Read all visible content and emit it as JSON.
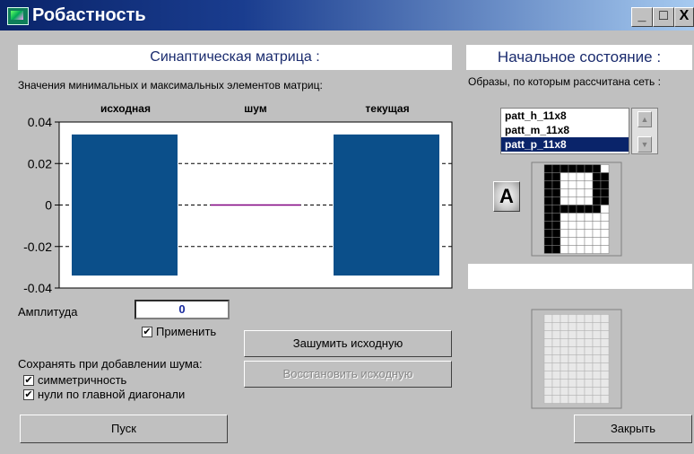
{
  "window": {
    "title": "Робастность",
    "minimize": "_",
    "maximize": "□",
    "close": "X"
  },
  "synaptic": {
    "header": "Синаптическая матрица :",
    "caption": "Значения минимальных и максимальных элементов матриц:",
    "col_labels": [
      "исходная",
      "шум",
      "текущая"
    ],
    "amplitude_label": "Амплитуда",
    "amplitude_value": "0",
    "apply_label": "Применить",
    "apply_checked": true,
    "save_caption": "Сохранять при добавлении шума:",
    "symmetry_label": "симметричность",
    "symmetry_checked": true,
    "zeros_label": "нули по главной диагонали",
    "zeros_checked": true,
    "noise_button": "Зашумить исходную",
    "restore_button": "Восстановить исходную",
    "start_button": "Пуск"
  },
  "chart_data": {
    "type": "bar",
    "categories": [
      "исходная",
      "шум",
      "текущая"
    ],
    "series": [
      {
        "values": [
          0.034,
          0.0,
          0.034
        ]
      },
      {
        "values": [
          -0.034,
          0.0,
          -0.034
        ]
      }
    ],
    "ylim": [
      -0.04,
      0.04
    ],
    "yticks": [
      "0.04",
      "0.02",
      "0",
      "-0.02",
      "-0.04"
    ],
    "grid": true,
    "bar_color": "#0b4f8a",
    "noise_line_color": "#800080"
  },
  "initial": {
    "header": "Начальное состояние :",
    "caption": "Образы, по которым рассчитана сеть :",
    "patterns": [
      "patt_h_11x8",
      "patt_m_11x8",
      "patt_p_11x8"
    ],
    "selected_index": 2,
    "close_button": "Закрыть",
    "pattern_icon": "A-pattern-icon"
  }
}
